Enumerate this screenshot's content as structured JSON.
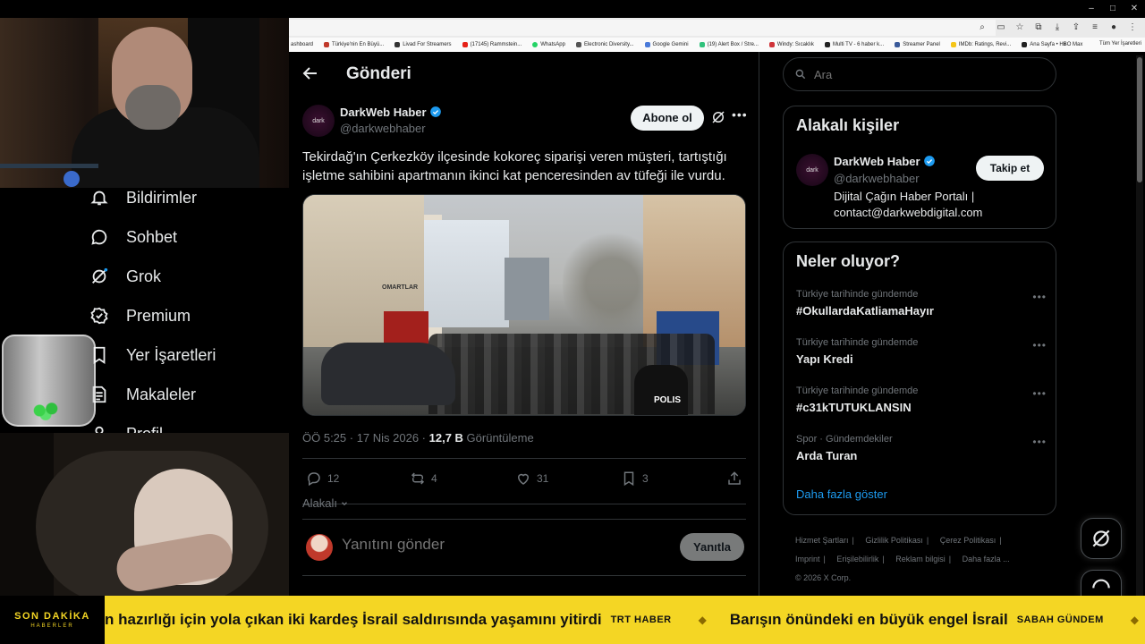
{
  "browser": {
    "bookmarks": [
      "ashboard",
      "Türkiye'nin En Büyü...",
      "Livad For Streamers",
      "(17145) Rammstein...",
      "WhatsApp",
      "Electronic Diversity...",
      "Google Gemini",
      "(19) Alert Box / Stre...",
      "Windy: Sıcaklık",
      "Multi TV - 6 haber k...",
      "Streamer Panel",
      "IMDb: Ratings, Revi...",
      "Ana Sayfa • HBO Max"
    ],
    "bookmarks_more": "»",
    "all_bookmarks": "Tüm Yer İşaretleri",
    "window_controls": [
      "–",
      "□",
      "✕"
    ]
  },
  "nav": {
    "items": [
      {
        "label": "Bildirimler",
        "icon": "bell-icon"
      },
      {
        "label": "Sohbet",
        "icon": "chat-icon"
      },
      {
        "label": "Grok",
        "icon": "grok-icon"
      },
      {
        "label": "Premium",
        "icon": "premium-icon"
      },
      {
        "label": "Yer İşaretleri",
        "icon": "bookmark-icon"
      },
      {
        "label": "Makaleler",
        "icon": "article-icon"
      },
      {
        "label": "Profil",
        "icon": "profile-icon"
      }
    ]
  },
  "main": {
    "title": "Gönderi",
    "tweet": {
      "author_name": "DarkWeb Haber",
      "author_handle": "@darkwebhaber",
      "avatar_text": "dark",
      "follow_label": "Abone ol",
      "text": "Tekirdağ'ın Çerkezköy ilçesinde kokoreç siparişi veren müşteri, tartıştığı işletme sahibini apartmanın ikinci kat penceresinden av tüfeği ile vurdu.",
      "timestamp": "ÖÖ 5:25 · 17 Nis 2026 · ",
      "views": "12,7 B",
      "views_label": " Görüntüleme",
      "replies": "12",
      "reposts": "4",
      "likes": "31",
      "bookmarks": "3",
      "image_sign": "OMARTLAR",
      "image_police": "POLIS"
    },
    "relevance_label": "Alakalı",
    "reply_placeholder": "Yanıtını gönder",
    "reply_button": "Yanıtla"
  },
  "right": {
    "search_placeholder": "Ara",
    "people_title": "Alakalı kişiler",
    "person": {
      "name": "DarkWeb Haber",
      "handle": "@darkwebhaber",
      "bio": "Dijital Çağın Haber Portalı | contact@darkwebdigital.com",
      "follow_label": "Takip et",
      "avatar_text": "dark"
    },
    "trends_title": "Neler oluyor?",
    "trends": [
      {
        "category": "Türkiye tarihinde gündemde",
        "name": "#OkullardaKatliamaHayır"
      },
      {
        "category": "Türkiye tarihinde gündemde",
        "name": "Yapı Kredi"
      },
      {
        "category": "Türkiye tarihinde gündemde",
        "name": "#c31kTUTUKLANSIN"
      },
      {
        "category": "Spor · Gündemdekiler",
        "name": "Arda Turan"
      }
    ],
    "show_more": "Daha fazla göster",
    "footer": {
      "links": [
        "Hizmet Şartları",
        "Gizlilik Politikası",
        "Çerez Politikası",
        "Imprint",
        "Erişilebilirlik",
        "Reklam bilgisi",
        "Daha fazla ..."
      ],
      "copyright": "© 2026 X Corp."
    }
  },
  "ticker": {
    "badge_title": "SON DAKİKA",
    "badge_sub": "HABERLER",
    "items": [
      {
        "headline": "n hazırlığı için yola çıkan iki kardeş İsrail saldırısında yaşamını yitirdi",
        "source": "TRT HABER"
      },
      {
        "headline": "Barışın önündeki en büyük engel İsrail",
        "source": "SABAH GÜNDEM"
      }
    ],
    "separator": "◆",
    "accent_color": "#f4d624"
  },
  "colors": {
    "background": "#000000",
    "text": "#e7e9ea",
    "muted": "#71767b",
    "link": "#1d9bf0",
    "verified": "#1d9bf0"
  }
}
